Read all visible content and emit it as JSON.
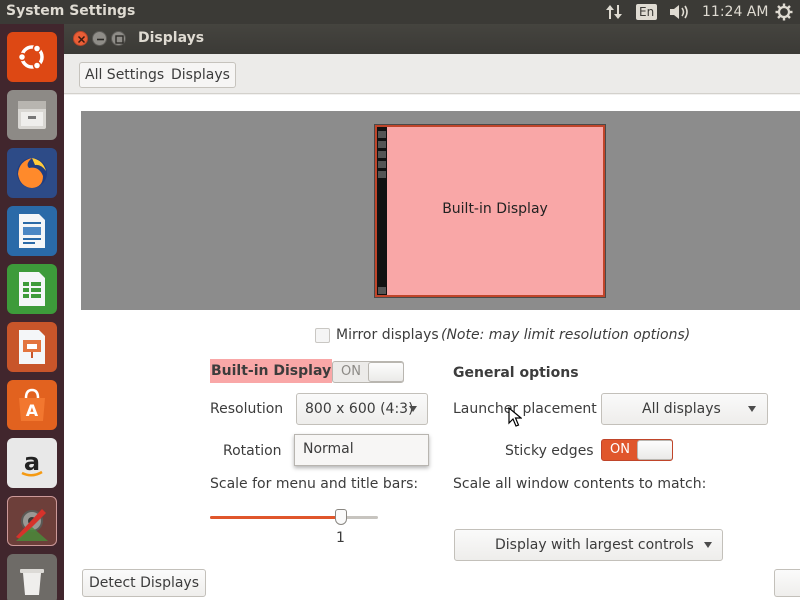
{
  "top_panel": {
    "app_title": "System Settings",
    "network_icon": "network-updown-icon",
    "keyboard_layout": "En",
    "volume_icon": "volume-icon",
    "clock": "11:24 AM",
    "settings_icon": "gear-icon"
  },
  "launcher": {
    "items": [
      "ubuntu-dash-icon",
      "files-icon",
      "firefox-icon",
      "libreoffice-writer-icon",
      "libreoffice-calc-icon",
      "libreoffice-impress-icon",
      "ubuntu-software-icon",
      "amazon-icon",
      "system-settings-icon",
      "trash-icon"
    ]
  },
  "window": {
    "title": "Displays",
    "breadcrumbs": [
      "All Settings",
      "Displays"
    ]
  },
  "arrangement": {
    "monitor_label": "Built-in Display"
  },
  "mirror": {
    "label": "Mirror displays",
    "note": "(Note: may limit resolution options)",
    "checked": false
  },
  "display_panel": {
    "heading": "Built-in Display",
    "power_toggle": "ON",
    "power_on": false,
    "resolution_label": "Resolution",
    "resolution_value": "800 x 600 (4:3)",
    "rotation_label": "Rotation",
    "rotation_value": "Normal",
    "scale_label": "Scale for menu and title bars:",
    "scale_value": "1",
    "scale_fraction": 0.78
  },
  "general_options": {
    "heading": "General options",
    "launcher_placement_label": "Launcher placement",
    "launcher_placement_value": "All displays",
    "sticky_edges_label": "Sticky edges",
    "sticky_edges_toggle": "ON",
    "sticky_edges_on": true,
    "scale_all_label": "Scale all window contents to match:",
    "scale_all_value": "Display with largest controls"
  },
  "footer": {
    "detect_button": "Detect Displays"
  },
  "colors": {
    "accent": "#e0562b",
    "monitor_fill": "#f9a7a7",
    "heading_highlight": "#f9a7a7",
    "top_panel": "#3b3a36",
    "launcher": "#41262d"
  }
}
